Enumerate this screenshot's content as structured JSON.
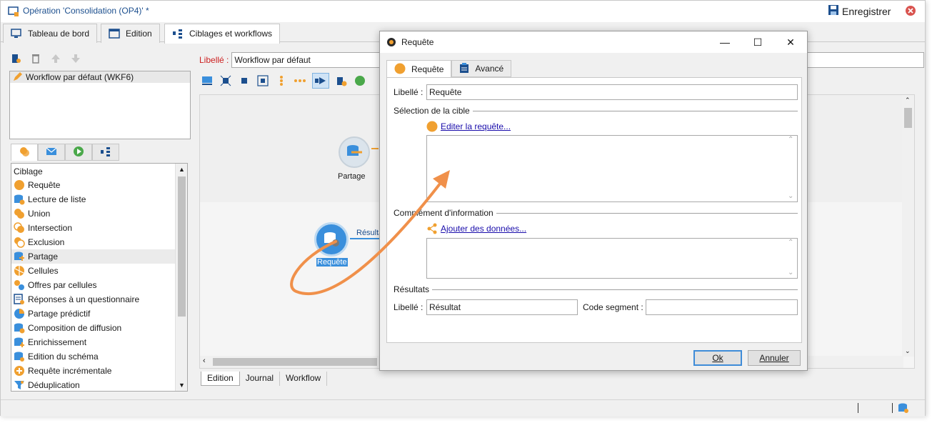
{
  "window": {
    "title": "Opération 'Consolidation (OP4)' *",
    "save_label": "Enregistrer"
  },
  "tabs": [
    {
      "label": "Tableau de bord"
    },
    {
      "label": "Edition"
    },
    {
      "label": "Ciblages et workflows"
    }
  ],
  "workflow_list": {
    "items": [
      "Workflow par défaut (WKF6)"
    ]
  },
  "libelle": {
    "label": "Libellé :",
    "value": "Workflow par défaut"
  },
  "palette": {
    "heading": "Ciblage",
    "items": [
      "Requête",
      "Lecture de liste",
      "Union",
      "Intersection",
      "Exclusion",
      "Partage",
      "Cellules",
      "Offres par cellules",
      "Réponses à un questionnaire",
      "Partage prédictif",
      "Composition de diffusion",
      "Enrichissement",
      "Edition du schéma",
      "Requête incrémentale",
      "Déduplication"
    ]
  },
  "canvas": {
    "node_partage": "Partage",
    "node_requete": "Requête",
    "transition_label": "Résulta"
  },
  "bottom_tabs": [
    "Edition",
    "Journal",
    "Workflow"
  ],
  "dialog": {
    "title": "Requête",
    "tabs": [
      "Requête",
      "Avancé"
    ],
    "libelle_label": "Libellé :",
    "libelle_value": "Requête",
    "section_cible": "Sélection de la cible",
    "edit_link": "Editer la requête...",
    "section_complement": "Complément d'information",
    "add_link": "Ajouter des données...",
    "section_resultats": "Résultats",
    "result_label": "Libellé :",
    "result_value": "Résultat",
    "segment_label": "Code segment :",
    "segment_value": "",
    "ok_label": "Ok",
    "cancel_label": "Annuler"
  },
  "colors": {
    "accent_orange": "#f0a030",
    "accent_blue": "#3a8fdc",
    "arrow": "#f0904a",
    "title_blue": "#1c4f8e"
  }
}
